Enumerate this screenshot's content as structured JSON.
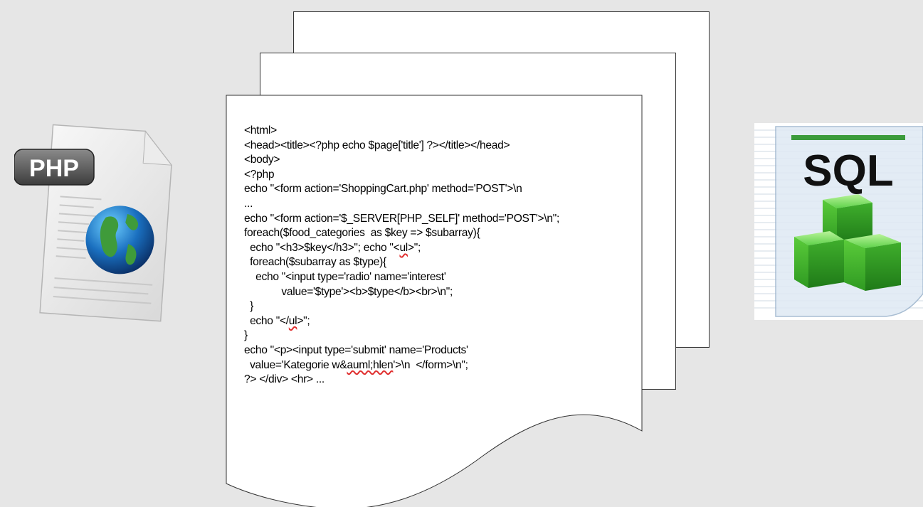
{
  "php_icon": {
    "icon": "php-file-icon",
    "badge_label": "PHP"
  },
  "sql_icon": {
    "icon": "sql-database-icon",
    "label": "SQL",
    "accent": "#3b9b3b"
  },
  "code_lines": [
    "<html>",
    "<head><title><?php echo $page['title'] ?></title></head>",
    "<body>",
    "<?php",
    "echo \"<form action='ShoppingCart.php' method='POST'>\\n",
    "...",
    "echo \"<form action='$_SERVER[PHP_SELF]' method='POST'>\\n\";",
    "foreach($food_categories  as $key => $subarray){",
    "  echo \"<h3>$key</h3>\"; echo \"<ul>\";",
    "  foreach($subarray as $type){",
    "    echo \"<input type='radio' name='interest'",
    "             value='$type'><b>$type</b><br>\\n\";",
    "  }",
    "  echo \"</ul>\";",
    "}",
    "echo \"<p><input type='submit' name='Products'",
    "  value='Kategorie w&auml;hlen'>\\n  </form>\\n\";",
    "?> </div> <hr> ..."
  ]
}
